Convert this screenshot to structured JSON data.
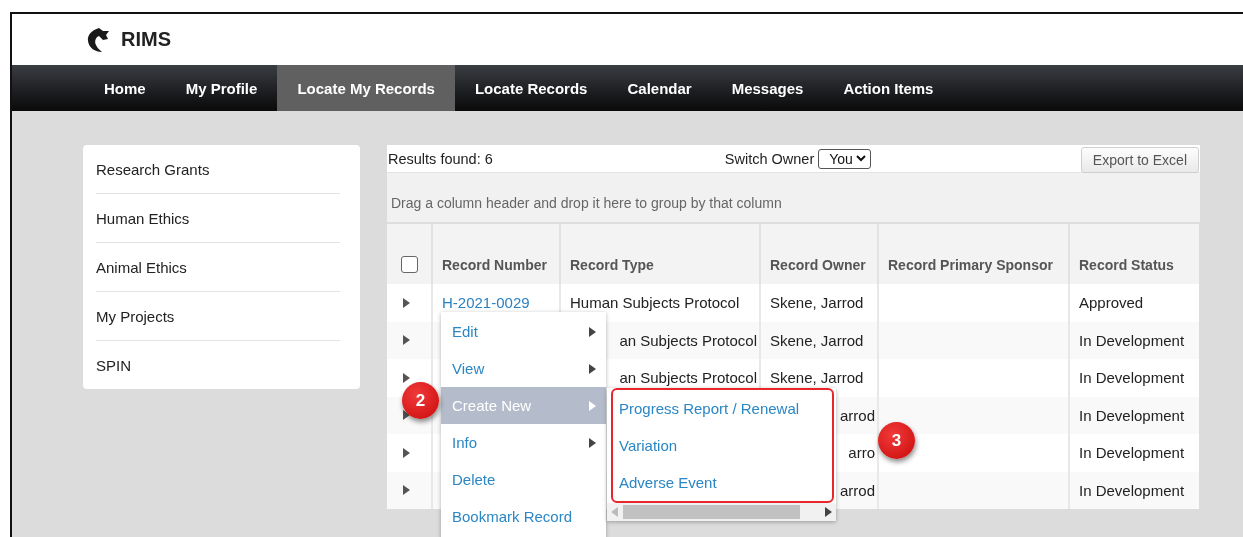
{
  "app": {
    "name": "RIMS"
  },
  "nav": [
    {
      "label": "Home",
      "selected": false
    },
    {
      "label": "My Profile",
      "selected": false
    },
    {
      "label": "Locate My Records",
      "selected": true
    },
    {
      "label": "Locate Records",
      "selected": false
    },
    {
      "label": "Calendar",
      "selected": false
    },
    {
      "label": "Messages",
      "selected": false
    },
    {
      "label": "Action Items",
      "selected": false
    }
  ],
  "sidebar": {
    "items": [
      "Research Grants",
      "Human Ethics",
      "Animal Ethics",
      "My Projects",
      "SPIN"
    ]
  },
  "grid": {
    "results": "Results found: 6",
    "switch_owner": {
      "label": "Switch Owner",
      "value": "You"
    },
    "export_button": "Export to Excel",
    "group_hint": "Drag a column header and drop it here to group by that column",
    "select_all": {
      "checked": false
    },
    "columns": [
      "Record Number",
      "Record Type",
      "Record Owner",
      "Record Primary Sponsor",
      "Record Status"
    ],
    "rows": [
      {
        "cells": [
          "H-2021-0029",
          "Human Subjects Protocol",
          "Skene, Jarrod",
          null,
          "Approved"
        ]
      },
      {
        "cells": [
          null,
          {
            "text": "an Subjects Protocol",
            "cut": true
          },
          "Skene, Jarrod",
          null,
          "In Development"
        ]
      },
      {
        "cells": [
          null,
          {
            "text": "an Subjects Protocol",
            "cut": true
          },
          "Skene, Jarrod",
          null,
          "In Development"
        ]
      },
      {
        "cells": [
          null,
          null,
          {
            "text": "arrod",
            "cut": true
          },
          null,
          "In Development"
        ]
      },
      {
        "cells": [
          null,
          null,
          {
            "text": "arro",
            "cut": true
          },
          null,
          "In Development"
        ]
      },
      {
        "cells": [
          null,
          null,
          {
            "text": "arrod",
            "cut": true
          },
          null,
          "In Development"
        ]
      }
    ]
  },
  "context_menu": {
    "items": [
      {
        "label": "Edit",
        "submenu": true,
        "selected": false
      },
      {
        "label": "View",
        "submenu": true,
        "selected": false
      },
      {
        "label": "Create New",
        "submenu": true,
        "selected": true
      },
      {
        "label": "Info",
        "submenu": true,
        "selected": false
      },
      {
        "label": "Delete",
        "submenu": false,
        "selected": false
      },
      {
        "label": "Bookmark Record",
        "submenu": false,
        "selected": false
      }
    ]
  },
  "submenu": {
    "items": [
      "Progress Report / Renewal",
      "Variation",
      "Adverse Event"
    ]
  },
  "annotations": [
    {
      "label": "2"
    },
    {
      "label": "3"
    }
  ]
}
